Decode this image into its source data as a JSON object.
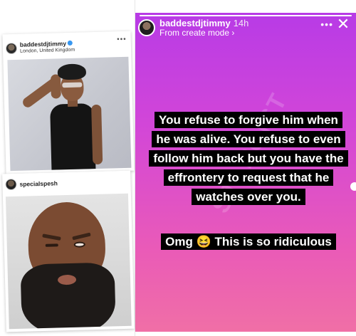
{
  "left_posts": [
    {
      "username": "baddestdjtimmy",
      "verified": true,
      "location": "London, United Kingdom",
      "more": "•••"
    },
    {
      "username": "specialspesh",
      "more": ""
    }
  ],
  "story": {
    "username": "baddestdjtimmy",
    "time": "14h",
    "subline": "From create mode ›",
    "more": "•••",
    "close": "✕",
    "text_main": "You refuse to forgive him when he was alive. You refuse to even follow him back but you have the effrontery to request that he watches over you.",
    "text_second": "Omg 😆 This is so ridiculous",
    "watermark": "STARGIST",
    "colors": {
      "gradient_top": "#b83be6",
      "gradient_bottom": "#f06fa6",
      "caption_bg": "#000000",
      "caption_text": "#ffffff"
    }
  }
}
